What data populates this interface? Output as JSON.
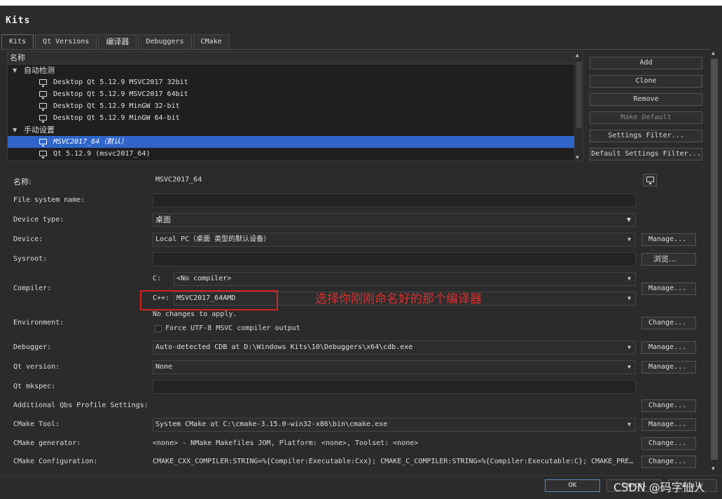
{
  "window": {
    "title": "Kits"
  },
  "tabs": [
    "Kits",
    "Qt Versions",
    "编译器",
    "Debuggers",
    "CMake"
  ],
  "tree": {
    "header": "名称",
    "groups": [
      {
        "label": "自动检测",
        "items": [
          "Desktop Qt 5.12.9 MSVC2017 32bit",
          "Desktop Qt 5.12.9 MSVC2017 64bit",
          "Desktop Qt 5.12.9 MinGW 32-bit",
          "Desktop Qt 5.12.9 MinGW 64-bit"
        ]
      },
      {
        "label": "手动设置",
        "items": [
          "MSVC2017_64（默认）",
          "Qt 5.12.9 (msvc2017_64)"
        ]
      }
    ],
    "selected_item": "MSVC2017_64（默认）"
  },
  "side_buttons": [
    "Add",
    "Clone",
    "Remove",
    "Make Default",
    "Settings Filter...",
    "Default Settings Filter..."
  ],
  "form": {
    "name_label": "名称:",
    "name_value": "MSVC2017_64",
    "fs_label": "File system name:",
    "fs_value": "",
    "device_type_label": "Device type:",
    "device_type_value": "桌面",
    "device_label": "Device:",
    "device_value": "Local PC（桌面 类型的默认设备）",
    "sysroot_label": "Sysroot:",
    "sysroot_value": "",
    "browse_label": "浏览...",
    "compiler_label": "Compiler:",
    "c_label": "C:",
    "c_value": "<No compiler>",
    "cpp_label": "C++:",
    "cpp_value": "MSVC2017_64AMD",
    "environment_label": "Environment:",
    "environment_value": "No changes to apply.",
    "force_utf8_label": "Force UTF-8 MSVC compiler output",
    "debugger_label": "Debugger:",
    "debugger_value": "Auto-detected CDB at D:\\Windows Kits\\10\\Debuggers\\x64\\cdb.exe",
    "qt_version_label": "Qt version:",
    "qt_version_value": "None",
    "qt_mkspec_label": "Qt mkspec:",
    "qt_mkspec_value": "",
    "qbs_label": "Additional Qbs Profile Settings:",
    "cmake_tool_label": "CMake Tool:",
    "cmake_tool_value": "System CMake at C:\\cmake-3.15.0-win32-x86\\bin\\cmake.exe",
    "cmake_gen_label": "CMake generator:",
    "cmake_gen_value": "<none> - NMake Makefiles JOM, Platform: <none>, Toolset: <none>",
    "cmake_conf_label": "CMake Configuration:",
    "cmake_conf_value": "CMAKE_CXX_COMPILER:STRING=%{Compiler:Executable:Cxx}; CMAKE_C_COMPILER:STRING=%{Compiler:Executable:C}; CMAKE_PRE…",
    "manage_label": "Manage...",
    "change_label": "Change..."
  },
  "annotation": "选择你刚刚命名好的那个编译器",
  "footer": {
    "ok": "OK",
    "cancel": "Cancel",
    "apply": "Apply"
  },
  "watermark": "CSDN @码字仙人"
}
